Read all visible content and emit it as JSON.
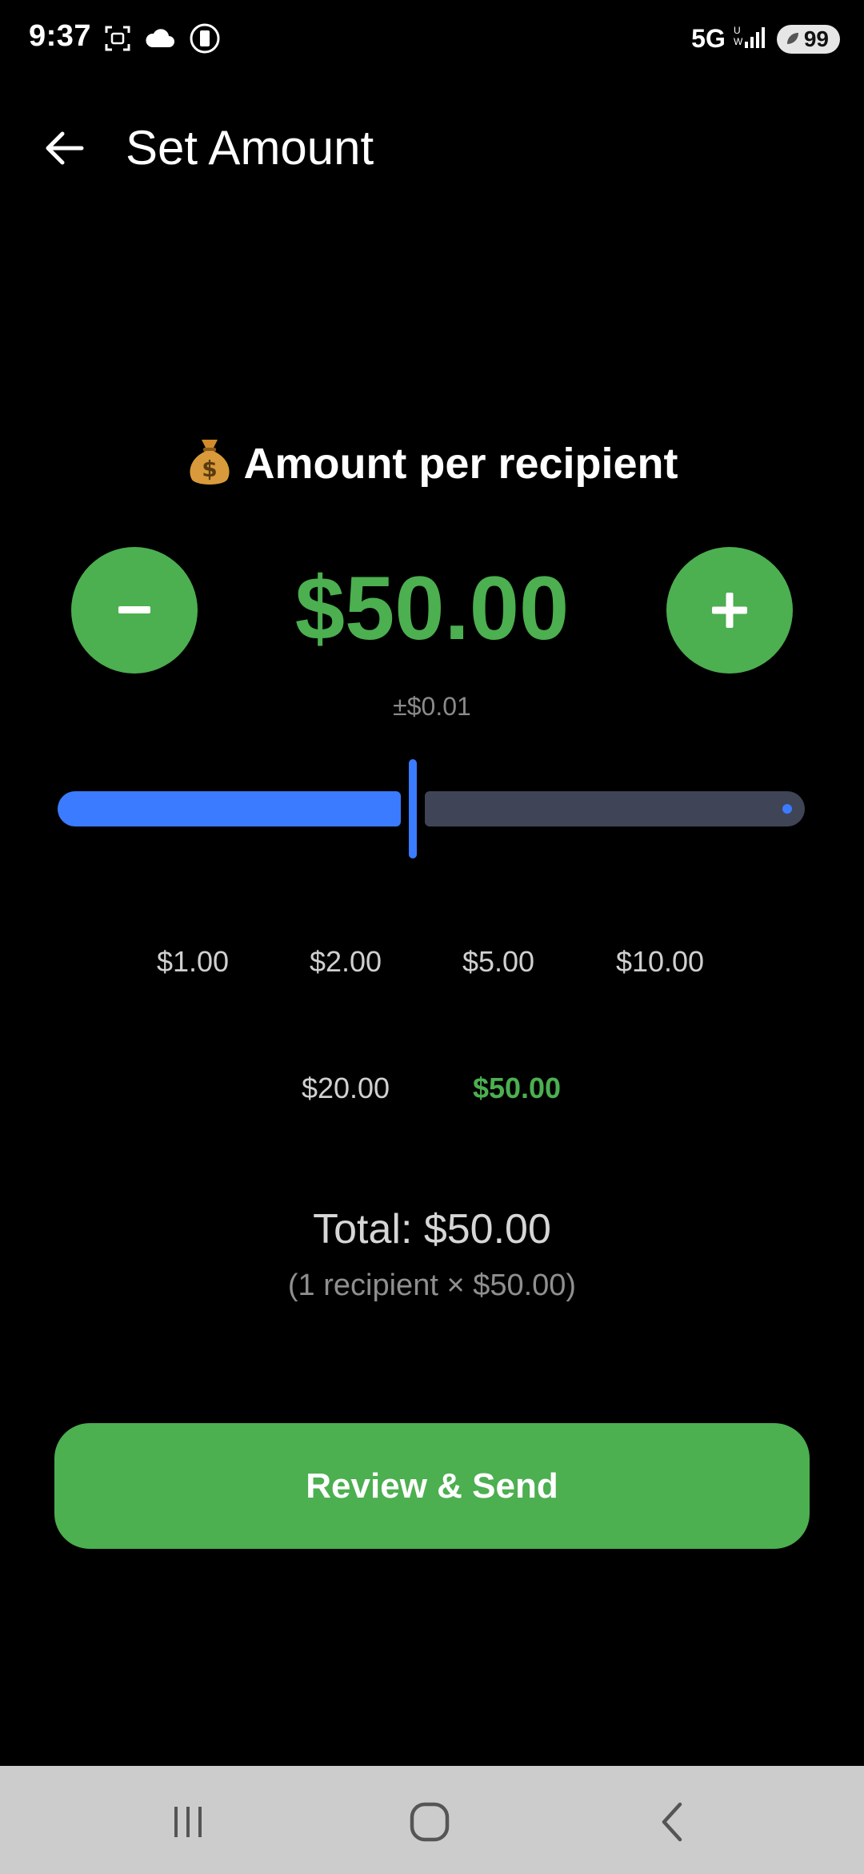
{
  "status_bar": {
    "time": "9:37",
    "network": "5G",
    "battery": "99",
    "icons": [
      "screenshot-icon",
      "cloud-icon",
      "phone-in-circle-icon",
      "signal-icon",
      "battery-saver-icon"
    ]
  },
  "header": {
    "title": "Set Amount",
    "back_icon": "arrow-left-icon"
  },
  "amount_section": {
    "heading": "Amount per recipient",
    "heading_icon": "money-bag-icon",
    "amount": "$50.00",
    "precision": "±$0.01",
    "decrease_icon": "minus-icon",
    "increase_icon": "plus-icon"
  },
  "slider": {
    "level": 0.47
  },
  "presets": [
    {
      "label": "$1.00",
      "selected": false
    },
    {
      "label": "$2.00",
      "selected": false
    },
    {
      "label": "$5.00",
      "selected": false
    },
    {
      "label": "$10.00",
      "selected": false
    },
    {
      "label": "$20.00",
      "selected": false
    },
    {
      "label": "$50.00",
      "selected": true
    }
  ],
  "summary": {
    "total": "Total: $50.00",
    "breakdown": "(1 recipient × $50.00)"
  },
  "actions": {
    "primary_label": "Review & Send"
  },
  "colors": {
    "accent_green": "#4caf50",
    "slider_blue": "#3b7bff",
    "slider_track": "#3f4456",
    "background": "#000000"
  },
  "nav_bar": {
    "items": [
      "recents-icon",
      "home-icon",
      "back-icon"
    ]
  }
}
